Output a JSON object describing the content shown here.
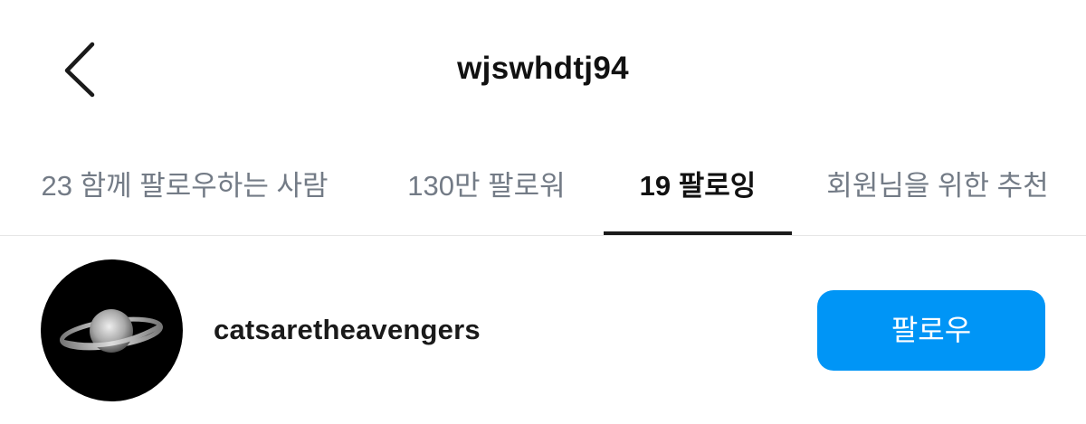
{
  "header": {
    "back_icon": "chevron-left-icon",
    "title": "wjswhdtj94"
  },
  "tabs": [
    {
      "label": "23 함께 팔로우하는 사람",
      "active": false
    },
    {
      "label": "130만 팔로워",
      "active": false
    },
    {
      "label": "19 팔로잉",
      "active": true
    },
    {
      "label": "회원님을 위한 추천",
      "active": false
    }
  ],
  "following_list": [
    {
      "username": "catsaretheavengers",
      "avatar": "saturn-planet-image",
      "follow_label": "팔로우"
    }
  ],
  "colors": {
    "accent": "#0095f6",
    "inactive_tab": "#737b86",
    "text": "#111111",
    "divider": "#e6e6e6"
  }
}
